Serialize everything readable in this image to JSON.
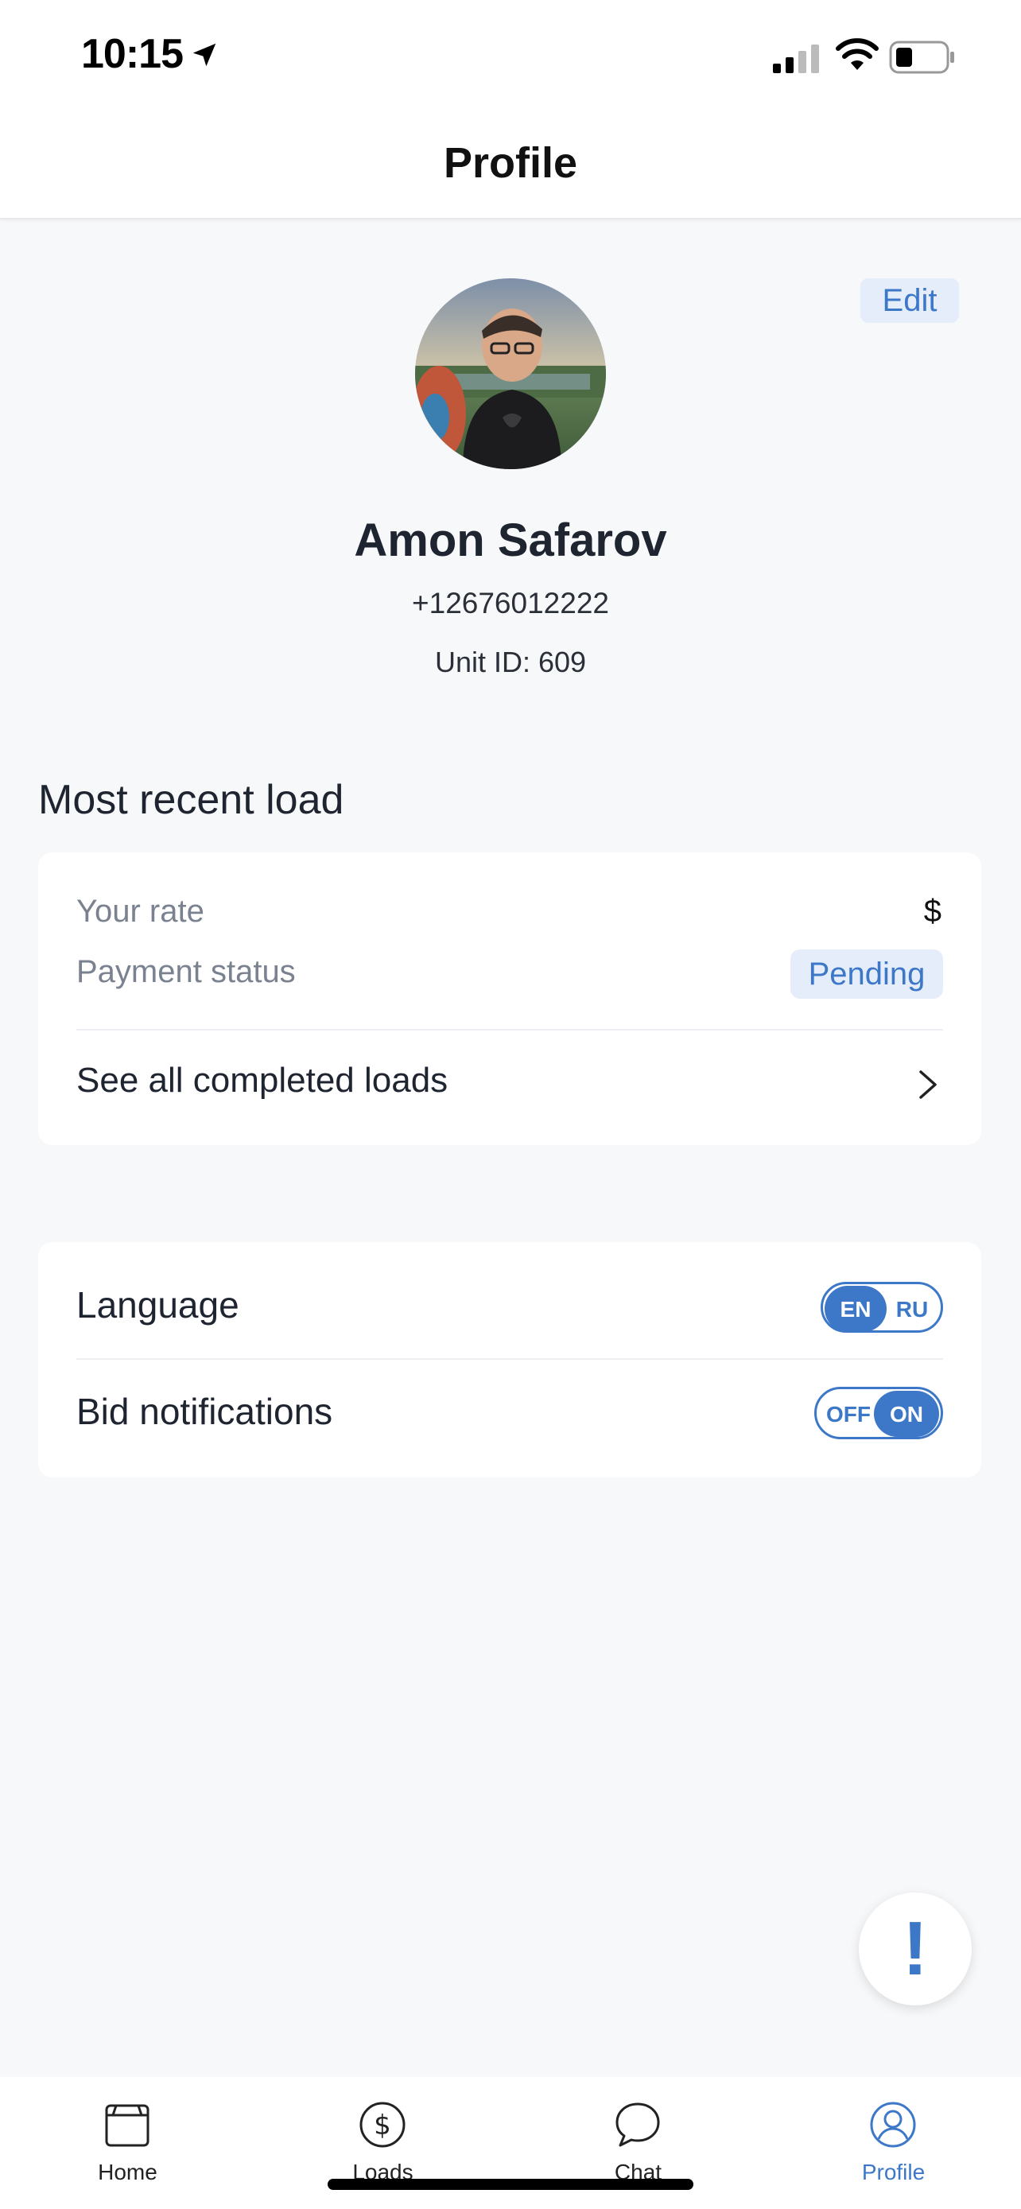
{
  "status_bar": {
    "time": "10:15"
  },
  "header": {
    "title": "Profile"
  },
  "profile": {
    "edit_label": "Edit",
    "name": "Amon Safarov",
    "phone": "+12676012222",
    "unit_id": "Unit ID: 609"
  },
  "recent_load": {
    "section_title": "Most recent load",
    "rate_label": "Your rate",
    "rate_value": "$",
    "payment_label": "Payment status",
    "payment_status": "Pending",
    "see_all_label": "See all completed loads"
  },
  "settings": {
    "language_label": "Language",
    "language_options": [
      "EN",
      "RU"
    ],
    "language_selected": "EN",
    "notifications_label": "Bid notifications",
    "notifications_options": [
      "OFF",
      "ON"
    ],
    "notifications_selected": "ON"
  },
  "fab": {
    "icon": "!"
  },
  "tabbar": {
    "items": [
      {
        "label": "Home",
        "icon": "box-icon"
      },
      {
        "label": "Loads",
        "icon": "dollar-circle-icon"
      },
      {
        "label": "Chat",
        "icon": "chat-bubble-icon"
      },
      {
        "label": "Profile",
        "icon": "user-circle-icon"
      }
    ],
    "active": "Profile"
  },
  "colors": {
    "accent": "#3d78c8",
    "accent_bg": "#e4edf9",
    "background": "#f7f8fa"
  }
}
